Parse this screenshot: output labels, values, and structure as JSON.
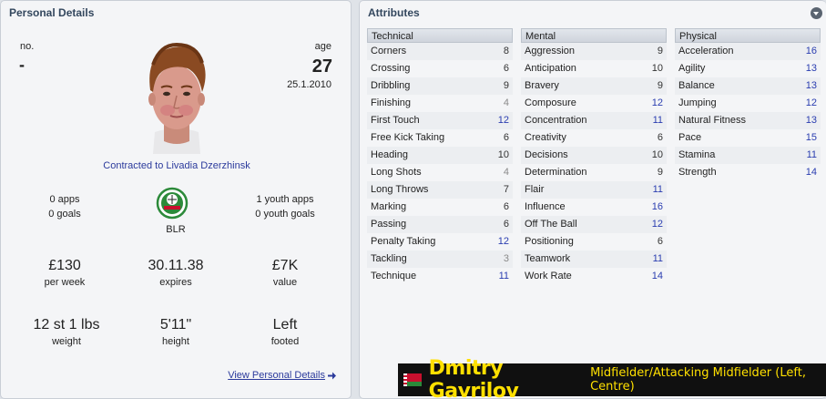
{
  "personal": {
    "title": "Personal Details",
    "no_label": "no.",
    "no_value": "-",
    "age_label": "age",
    "age_value": "27",
    "birth_date": "25.1.2010",
    "contract": "Contracted to Livadia Dzerzhinsk",
    "apps": "0 apps",
    "goals": "0 goals",
    "youth_apps": "1 youth apps",
    "youth_goals": "0 youth goals",
    "nation_code": "BLR",
    "wage_value": "£130",
    "wage_label": "per week",
    "expires_value": "30.11.38",
    "expires_label": "expires",
    "value_value": "£7K",
    "value_label": "value",
    "weight_value": "12 st 1 lbs",
    "weight_label": "weight",
    "height_value": "5'11\"",
    "height_label": "height",
    "foot_value": "Left",
    "foot_label": "footed",
    "view_link": "View Personal Details"
  },
  "attributes": {
    "title": "Attributes",
    "technical": {
      "heading": "Technical",
      "items": [
        {
          "name": "Corners",
          "value": "8"
        },
        {
          "name": "Crossing",
          "value": "6"
        },
        {
          "name": "Dribbling",
          "value": "9"
        },
        {
          "name": "Finishing",
          "value": "4"
        },
        {
          "name": "First Touch",
          "value": "12"
        },
        {
          "name": "Free Kick Taking",
          "value": "6"
        },
        {
          "name": "Heading",
          "value": "10"
        },
        {
          "name": "Long Shots",
          "value": "4"
        },
        {
          "name": "Long Throws",
          "value": "7"
        },
        {
          "name": "Marking",
          "value": "6"
        },
        {
          "name": "Passing",
          "value": "6"
        },
        {
          "name": "Penalty Taking",
          "value": "12"
        },
        {
          "name": "Tackling",
          "value": "3"
        },
        {
          "name": "Technique",
          "value": "11"
        }
      ]
    },
    "mental": {
      "heading": "Mental",
      "items": [
        {
          "name": "Aggression",
          "value": "9"
        },
        {
          "name": "Anticipation",
          "value": "10"
        },
        {
          "name": "Bravery",
          "value": "9"
        },
        {
          "name": "Composure",
          "value": "12"
        },
        {
          "name": "Concentration",
          "value": "11"
        },
        {
          "name": "Creativity",
          "value": "6"
        },
        {
          "name": "Decisions",
          "value": "10"
        },
        {
          "name": "Determination",
          "value": "9"
        },
        {
          "name": "Flair",
          "value": "11"
        },
        {
          "name": "Influence",
          "value": "16"
        },
        {
          "name": "Off The Ball",
          "value": "12"
        },
        {
          "name": "Positioning",
          "value": "6"
        },
        {
          "name": "Teamwork",
          "value": "11"
        },
        {
          "name": "Work Rate",
          "value": "14"
        }
      ]
    },
    "physical": {
      "heading": "Physical",
      "items": [
        {
          "name": "Acceleration",
          "value": "16"
        },
        {
          "name": "Agility",
          "value": "13"
        },
        {
          "name": "Balance",
          "value": "13"
        },
        {
          "name": "Jumping",
          "value": "12"
        },
        {
          "name": "Natural Fitness",
          "value": "13"
        },
        {
          "name": "Pace",
          "value": "15"
        },
        {
          "name": "Stamina",
          "value": "11"
        },
        {
          "name": "Strength",
          "value": "14"
        }
      ]
    }
  },
  "player": {
    "name": "Dmitry Gavrilov",
    "position": "Midfielder/Attacking Midfielder (Left, Centre)"
  },
  "icons": {
    "flag": "belarus-flag-icon",
    "badge": "federation-badge-icon",
    "arrow": "arrow-right-icon",
    "collapse": "chevron-down-icon"
  }
}
